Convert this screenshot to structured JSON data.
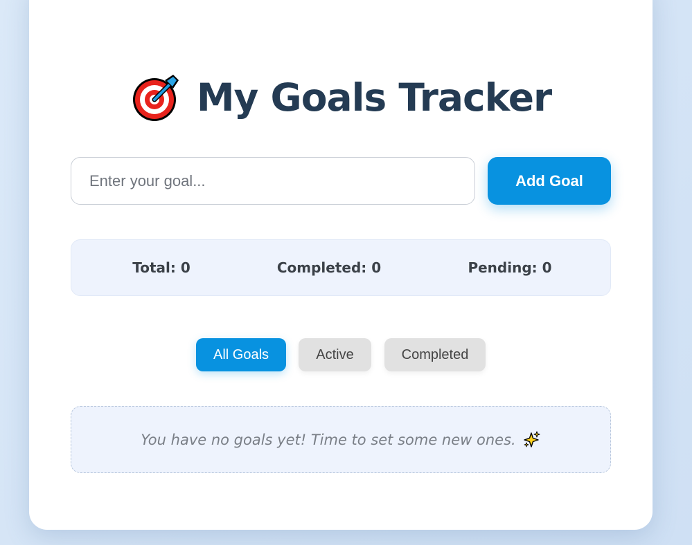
{
  "app": {
    "title": "My Goals Tracker",
    "title_icon": "target-icon"
  },
  "goal_input": {
    "placeholder": "Enter your goal...",
    "value": ""
  },
  "add_button": {
    "label": "Add Goal"
  },
  "stats": {
    "total": "Total: 0",
    "completed": "Completed: 0",
    "pending": "Pending: 0"
  },
  "filters": {
    "all": "All Goals",
    "active": "Active",
    "completed": "Completed",
    "selected": "all"
  },
  "empty_state": {
    "message": "You have no goals yet! Time to set some new ones.",
    "icon": "sparkles-icon"
  },
  "colors": {
    "accent": "#0892e0",
    "title": "#243b53",
    "panel_bg": "#eef3fd",
    "inactive_filter_bg": "#e1e1e1"
  }
}
